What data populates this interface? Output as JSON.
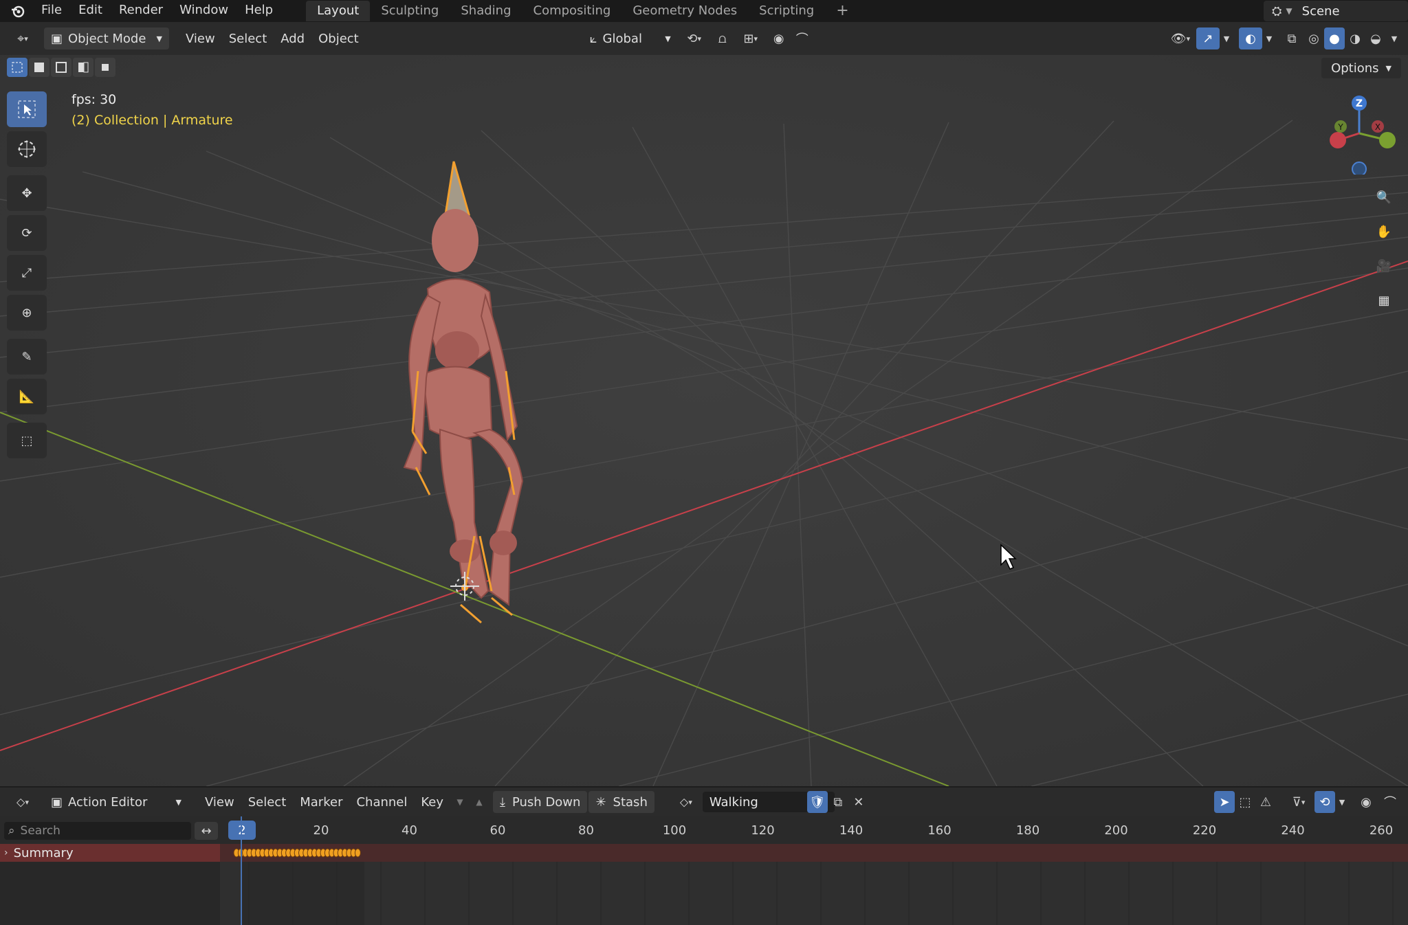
{
  "topbar": {
    "menus": [
      "File",
      "Edit",
      "Render",
      "Window",
      "Help"
    ],
    "workspaces": [
      "Layout",
      "Sculpting",
      "Shading",
      "Compositing",
      "Geometry Nodes",
      "Scripting"
    ],
    "active_workspace": "Layout",
    "add_workspace": "+",
    "scene": "Scene"
  },
  "view3d_header": {
    "mode": "Object Mode",
    "menus": [
      "View",
      "Select",
      "Add",
      "Object"
    ],
    "orientation": "Global",
    "options_label": "Options"
  },
  "viewport": {
    "fps_text": "fps: 30",
    "collection_text": "(2) Collection | Armature",
    "gizmo": {
      "z": "Z",
      "y": "Y",
      "x": "X"
    }
  },
  "action_editor": {
    "editor_type": "Action Editor",
    "menus": [
      "View",
      "Select",
      "Marker",
      "Channel",
      "Key"
    ],
    "push_down": "Push Down",
    "stash": "Stash",
    "action_name": "Walking",
    "search_placeholder": "Search",
    "current_frame": "2",
    "ruler_ticks": [
      "20",
      "40",
      "60",
      "80",
      "100",
      "120",
      "140",
      "160",
      "180",
      "200",
      "220",
      "240",
      "260"
    ],
    "summary_label": "Summary"
  },
  "colors": {
    "accent_blue": "#4772b3",
    "collection_yellow": "#f0d44a",
    "x_axis_red": "#c8404a",
    "y_axis_green": "#7a9a30",
    "keyframe_orange": "#f0a020",
    "body_pink": "#b56e66"
  }
}
